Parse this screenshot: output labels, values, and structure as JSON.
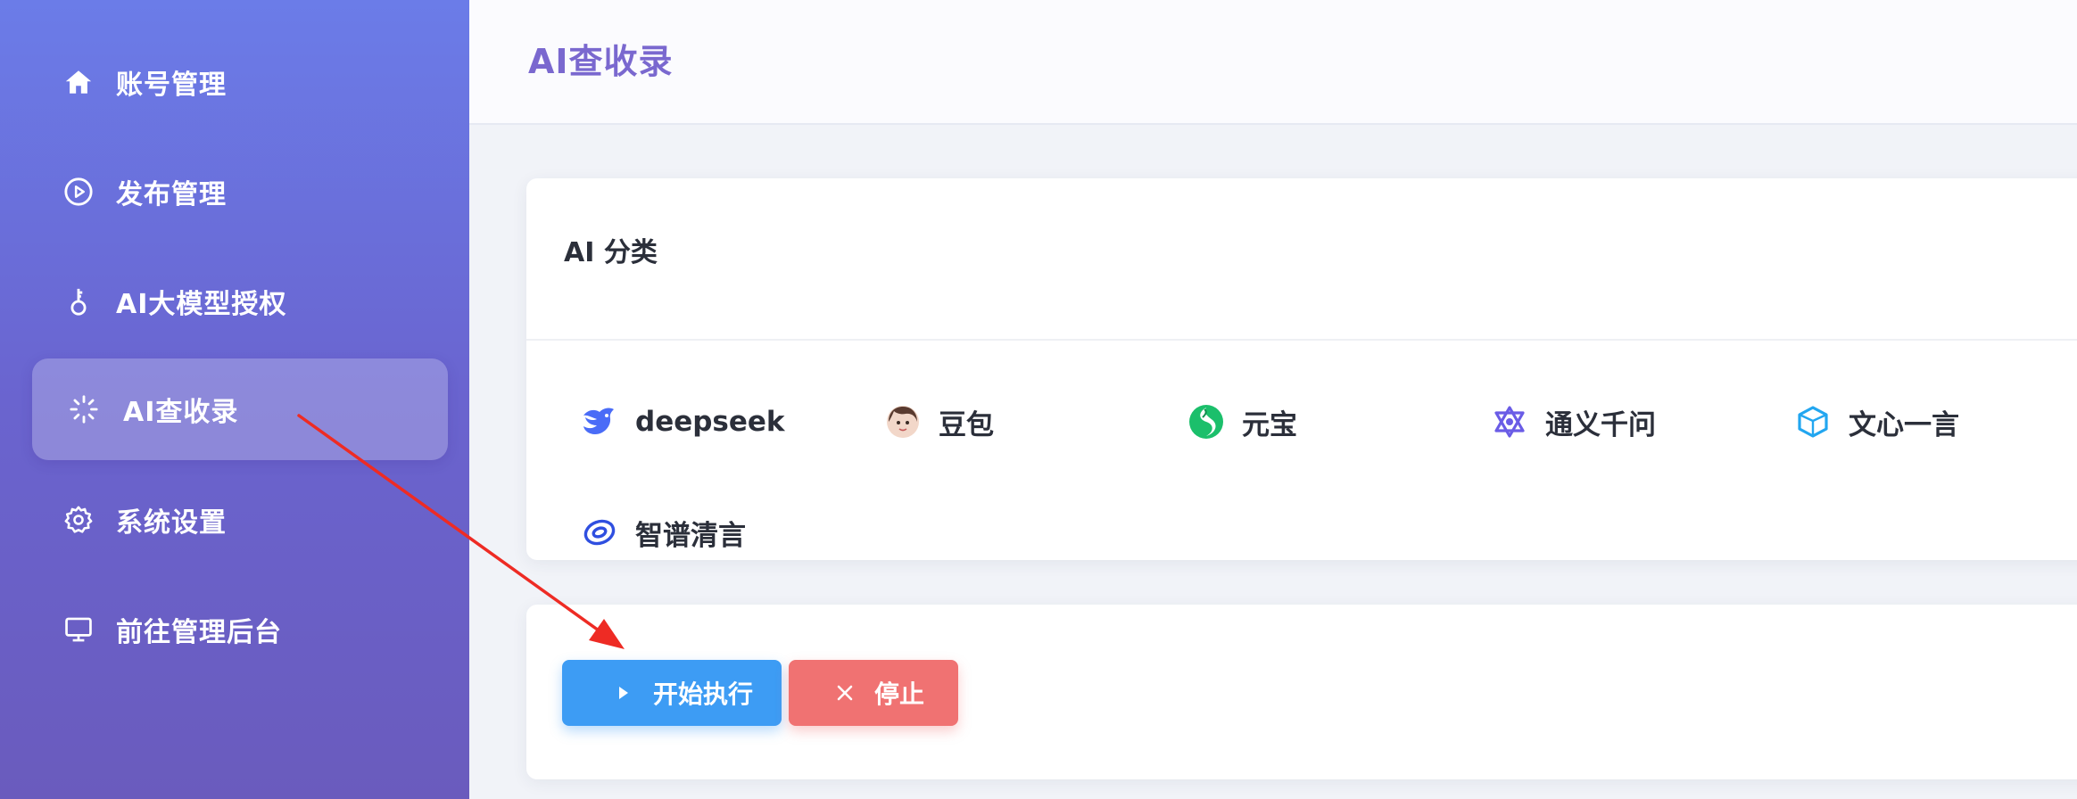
{
  "sidebar": {
    "items": [
      {
        "label": "账号管理",
        "icon": "home-icon"
      },
      {
        "label": "发布管理",
        "icon": "play-circle-icon"
      },
      {
        "label": "AI大模型授权",
        "icon": "key-icon"
      },
      {
        "label": "AI查收录",
        "icon": "loading-icon",
        "active": true
      },
      {
        "label": "系统设置",
        "icon": "gear-icon"
      },
      {
        "label": "前往管理后台",
        "icon": "monitor-icon"
      }
    ]
  },
  "header": {
    "title": "AI查收录"
  },
  "ai_card": {
    "title": "AI 分类",
    "items": [
      {
        "label": "deepseek",
        "icon": "deepseek-logo-icon"
      },
      {
        "label": "豆包",
        "icon": "doubao-avatar-icon"
      },
      {
        "label": "元宝",
        "icon": "yuanbao-logo-icon"
      },
      {
        "label": "通义千问",
        "icon": "tongyi-logo-icon"
      },
      {
        "label": "文心一言",
        "icon": "wenxin-logo-icon"
      },
      {
        "label": "智谱清言",
        "icon": "zhipu-logo-icon"
      }
    ]
  },
  "actions": {
    "start_label": "开始执行",
    "stop_label": "停止"
  },
  "colors": {
    "sidebar_gradient": [
      "#6b7ce8",
      "#6a5bbd"
    ],
    "title": "#7a68cf",
    "start_button": "#3d9cf4",
    "stop_button": "#f07272",
    "annotation_arrow": "#ee2b24"
  }
}
